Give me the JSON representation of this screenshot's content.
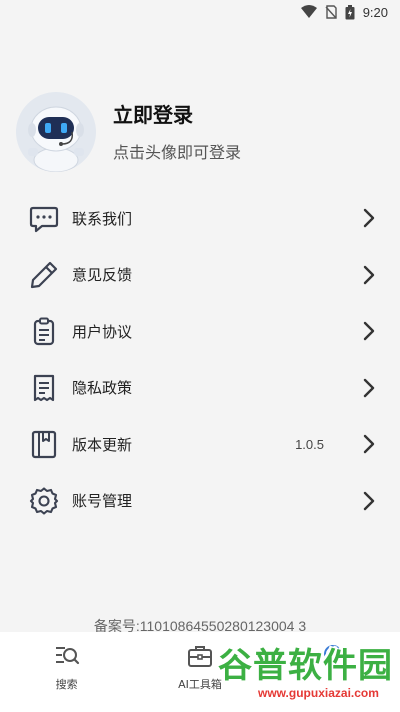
{
  "status_bar": {
    "time": "9:20",
    "icons": [
      "wifi-icon",
      "no-signal-icon",
      "battery-icon"
    ]
  },
  "profile": {
    "title": "立即登录",
    "subtitle": "点击头像即可登录",
    "avatar": "robot-avatar"
  },
  "menu": {
    "items": [
      {
        "label": "联系我们",
        "icon": "chat-icon"
      },
      {
        "label": "意见反馈",
        "icon": "pencil-icon"
      },
      {
        "label": "用户协议",
        "icon": "clipboard-icon"
      },
      {
        "label": "隐私政策",
        "icon": "document-icon"
      },
      {
        "label": "版本更新",
        "icon": "book-icon",
        "value": "1.0.5"
      },
      {
        "label": "账号管理",
        "icon": "gear-icon"
      }
    ]
  },
  "record": "备案号:11010864550280123004 3",
  "tabbar": {
    "tabs": [
      {
        "label": "搜索",
        "icon": "search-list-icon"
      },
      {
        "label": "AI工具箱",
        "icon": "toolbox-icon"
      },
      {
        "label": "",
        "icon": "profile-icon"
      }
    ]
  },
  "watermark": {
    "brand": "谷普软件园",
    "url": "www.gupuxiazai.com"
  },
  "colors": {
    "background": "#f4f4f4",
    "tabbar": "#ffffff",
    "icon": "#3c4252"
  }
}
